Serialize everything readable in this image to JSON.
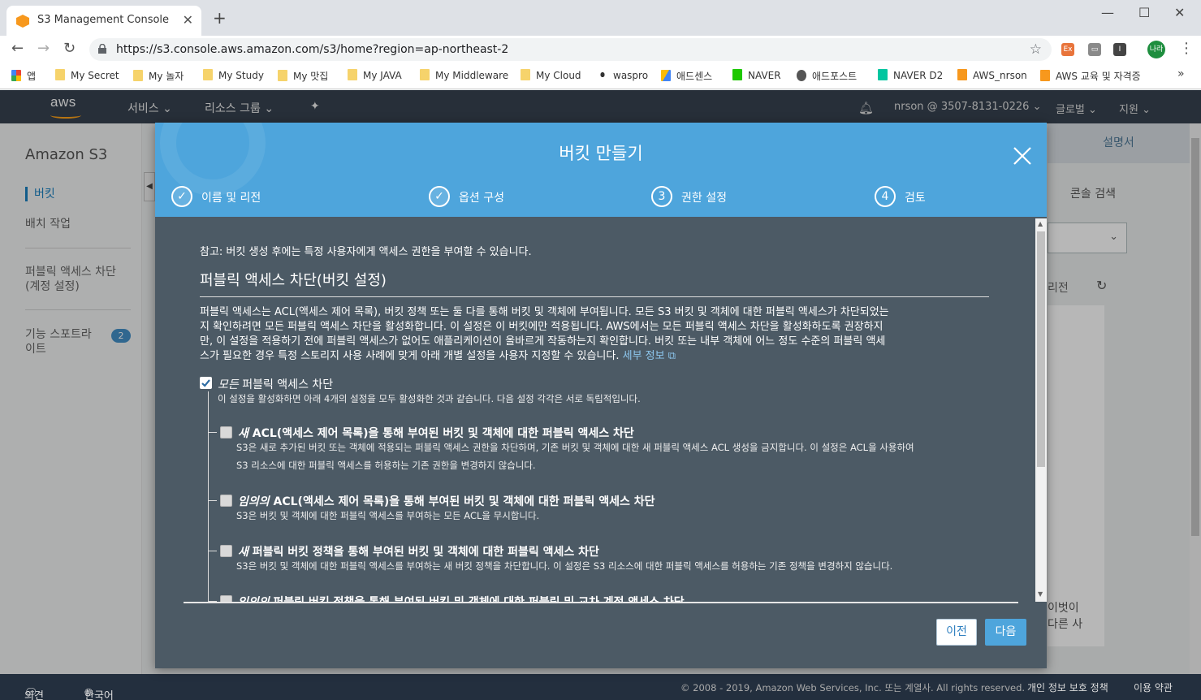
{
  "browser": {
    "tab_title": "S3 Management Console",
    "url": "https://s3.console.aws.amazon.com/s3/home?region=ap-northeast-2",
    "profile_initials": "나라",
    "bookmarks": [
      "앱",
      "My Secret",
      "My 놀자",
      "My Study",
      "My 맛집",
      "My JAVA",
      "My Middleware",
      "My Cloud",
      "waspro",
      "애드센스",
      "NAVER",
      "애드포스트",
      "NAVER D2",
      "AWS_nrson",
      "AWS 교육 및 자격증"
    ]
  },
  "aws_nav": {
    "logo": "aws",
    "services": "서비스",
    "resource_groups": "리소스 그룹",
    "account": "nrson @ 3507-8131-0226",
    "region": "글로벌",
    "support": "지원"
  },
  "sidebar": {
    "title": "Amazon S3",
    "items": [
      "버킷",
      "배치 작업",
      "퍼블릭 액세스 차단",
      "(계정 설정)",
      "기능 스포트라",
      "이트"
    ],
    "badge": "2"
  },
  "right_panel": {
    "docs": "설명서",
    "console_search": "콘솔 검색",
    "region_text": "리전",
    "partial_1": "이벗이",
    "partial_2": "다른 사"
  },
  "modal": {
    "title": "버킷 만들기",
    "steps": [
      {
        "num": "✓",
        "label": "이름 및 리전"
      },
      {
        "num": "✓",
        "label": "옵션 구성"
      },
      {
        "num": "3",
        "label": "권한 설정"
      },
      {
        "num": "4",
        "label": "검토"
      }
    ],
    "note": "참고: 버킷 생성 후에는 특정 사용자에게 액세스 권한을 부여할 수 있습니다.",
    "section_title": "퍼블릭 액세스 차단(버킷 설정)",
    "para_lines": [
      "퍼블릭 액세스는 ACL(액세스 제어 목록), 버킷 정책 또는 둘 다를 통해 버킷 및 객체에 부여됩니다. 모든 S3 버킷 및 객체에 대한 퍼블릭 액세스가 차단되었는",
      "지 확인하려면 모든 퍼블릭 액세스 차단을 활성화합니다. 이 설정은 이 버킷에만 적용됩니다. AWS에서는 모든 퍼블릭 액세스 차단을 활성화하도록 권장하지",
      "만, 이 설정을 적용하기 전에 퍼블릭 액세스가 없어도 애플리케이션이 올바르게 작동하는지 확인합니다. 버킷 또는 내부 객체에 어느 정도 수준의 퍼블릭 액세",
      "스가 필요한 경우 특정 스토리지 사용 사례에 맞게 아래 개별 설정을 사용자 지정할 수 있습니다."
    ],
    "learn_more": "세부 정보",
    "block_all": {
      "em": "모든",
      "label": " 퍼블릭 액세스 차단",
      "desc": "이 설정을 활성화하면 아래 4개의 설정을 모두 활성화한 것과 같습니다. 다음 설정 각각은 서로 독립적입니다."
    },
    "options": [
      {
        "em": "새",
        "label": " ACL(액세스 제어 목록)을 통해 부여된 버킷 및 객체에 대한 퍼블릭 액세스 차단",
        "desc1": "S3은 새로 추가된 버킷 또는 객체에 적용되는 퍼블릭 액세스 권한을 차단하며, 기존 버킷 및 객체에 대한 새 퍼블릭 액세스 ACL 생성을 금지합니다. 이 설정은 ACL을 사용하여",
        "desc2": "S3 리소스에 대한 퍼블릭 액세스를 허용하는 기존 권한을 변경하지 않습니다."
      },
      {
        "em": "임의의",
        "label": " ACL(액세스 제어 목록)을 통해 부여된 버킷 및 객체에 대한 퍼블릭 액세스 차단",
        "desc1": "S3은 버킷 및 객체에 대한 퍼블릭 액세스를 부여하는 모든 ACL을 무시합니다.",
        "desc2": ""
      },
      {
        "em": "새",
        "label": " 퍼블릭 버킷 정책을 통해 부여된 버킷 및 객체에 대한 퍼블릭 액세스 차단",
        "desc1": "S3은 버킷 및 객체에 대한 퍼블릭 액세스를 부여하는 새 버킷 정책을 차단합니다. 이 설정은 S3 리소스에 대한 퍼블릭 액세스를 허용하는 기존 정책을 변경하지 않습니다.",
        "desc2": ""
      },
      {
        "em": "임의의",
        "label": " 퍼블릭 버킷 정책을 통해 부여된 버킷 및 객체에 대한 퍼블릭 및 교차 계정 액세스 차단",
        "desc1": "",
        "desc2": ""
      }
    ],
    "prev_button": "이전",
    "next_button": "다음"
  },
  "footer": {
    "feedback": "의견",
    "language": "한국어",
    "copyright": "© 2008 - 2019, Amazon Web Services, Inc. 또는 계열사. All rights reserved.",
    "privacy": "개인 정보 보호 정책",
    "terms": "이용 약관"
  }
}
